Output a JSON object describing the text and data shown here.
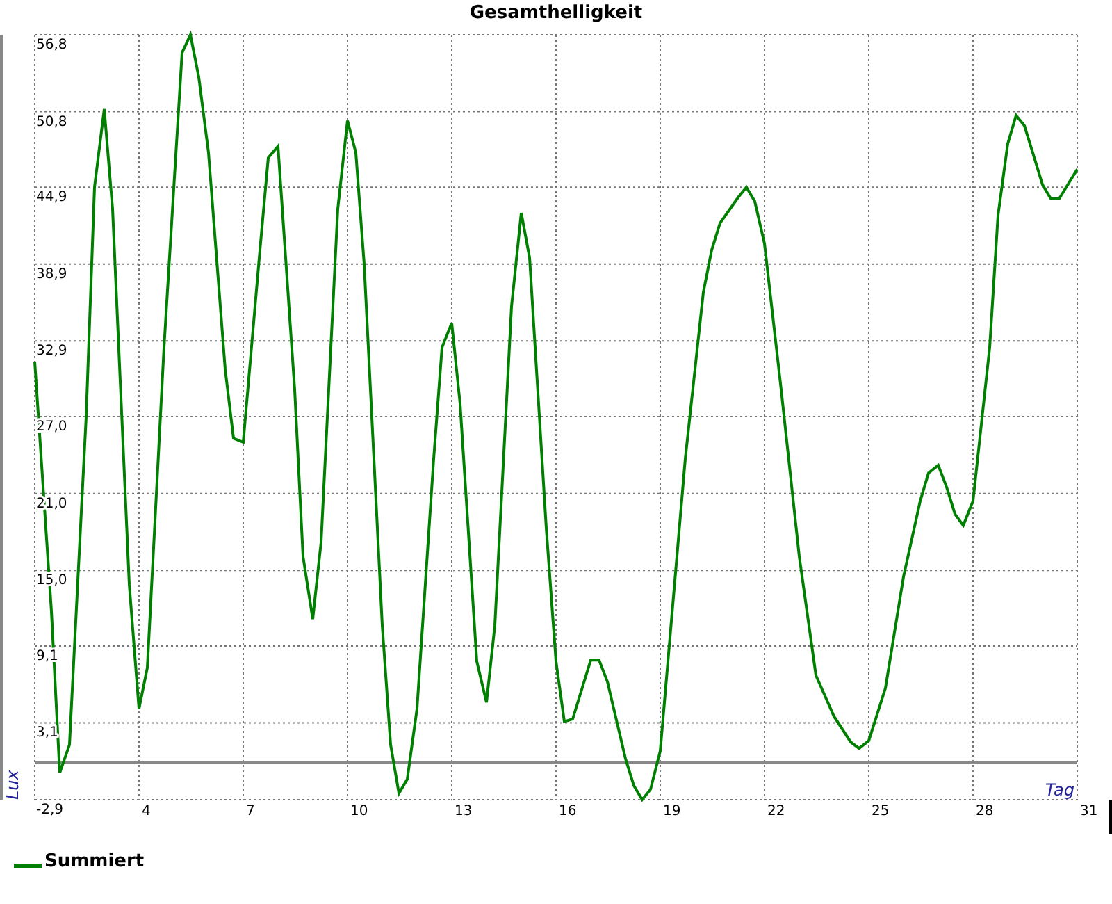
{
  "chart_data": {
    "type": "line",
    "title": "Gesamthelligkeit",
    "xlabel": "Tag",
    "ylabel": "Lux",
    "grid": true,
    "xlim": [
      0.75,
      31
    ],
    "ylim": [
      -2.9,
      56.8
    ],
    "xticks": [
      4,
      7,
      10,
      13,
      16,
      19,
      22,
      25,
      28,
      31
    ],
    "yticks": [
      {
        "value": 56.8,
        "label": "56,8"
      },
      {
        "value": 50.8,
        "label": "50,8"
      },
      {
        "value": 44.9,
        "label": "44,9"
      },
      {
        "value": 38.9,
        "label": "38,9"
      },
      {
        "value": 32.9,
        "label": "32,9"
      },
      {
        "value": 27.0,
        "label": "27,0"
      },
      {
        "value": 21.0,
        "label": "21,0"
      },
      {
        "value": 15.0,
        "label": "15,0"
      },
      {
        "value": 9.1,
        "label": "9,1"
      },
      {
        "value": 3.1,
        "label": "3,1"
      },
      {
        "value": -2.9,
        "label": "-2,9"
      }
    ],
    "x": [
      0.75,
      1.23,
      1.47,
      1.75,
      2.23,
      2.47,
      2.75,
      2.99,
      3.47,
      3.75,
      3.99,
      4.47,
      4.99,
      5.23,
      5.47,
      5.75,
      6.23,
      6.47,
      6.75,
      7.23,
      7.47,
      7.75,
      8.23,
      8.47,
      8.75,
      8.99,
      9.47,
      9.75,
      9.99,
      10.23,
      10.75,
      10.99,
      11.23,
      11.47,
      11.75,
      12.23,
      12.47,
      12.75,
      12.99,
      13.47,
      13.75,
      13.99,
      14.47,
      14.75,
      14.99,
      15.47,
      15.75,
      15.99,
      16.23,
      16.75,
      16.99,
      17.23,
      17.75,
      17.99,
      18.23,
      18.47,
      18.75,
      19.23,
      19.47,
      19.99,
      20.23,
      20.47,
      20.99,
      21.23,
      21.47,
      21.75,
      22.23,
      22.75,
      23.23,
      23.75,
      24.23,
      24.47,
      24.75,
      25.23,
      25.75,
      26.23,
      26.47,
      26.75,
      26.99,
      27.23,
      27.47,
      27.75,
      28.23,
      28.47,
      28.75,
      28.99,
      29.23,
      29.47,
      29.75,
      29.99,
      30.23,
      30.75
    ],
    "series": [
      {
        "name": "Summiert",
        "color": "#008000",
        "values": [
          31.3,
          11.8,
          -0.8,
          1.4,
          27.0,
          44.9,
          51.0,
          43.2,
          13.9,
          4.2,
          7.4,
          32.4,
          55.4,
          56.8,
          53.5,
          47.6,
          30.7,
          25.3,
          25.0,
          40.0,
          47.2,
          48.1,
          29.1,
          16.1,
          11.2,
          17.2,
          43.2,
          50.1,
          47.6,
          38.9,
          10.7,
          1.4,
          -2.4,
          -1.3,
          4.2,
          23.7,
          32.4,
          34.3,
          28.0,
          7.9,
          4.7,
          10.7,
          35.6,
          42.9,
          39.4,
          18.3,
          7.9,
          3.2,
          3.4,
          8.0,
          8.0,
          6.3,
          0.3,
          -1.8,
          -2.9,
          -2.1,
          0.9,
          16.1,
          23.7,
          36.7,
          40.0,
          42.1,
          44.1,
          44.9,
          43.8,
          40.5,
          29.1,
          16.1,
          6.8,
          3.6,
          1.6,
          1.1,
          1.7,
          5.8,
          14.5,
          20.4,
          22.6,
          23.2,
          21.5,
          19.4,
          18.5,
          20.4,
          32.4,
          42.7,
          48.3,
          50.5,
          49.7,
          47.6,
          45.1,
          44.0,
          44.0,
          46.3
        ]
      }
    ]
  }
}
